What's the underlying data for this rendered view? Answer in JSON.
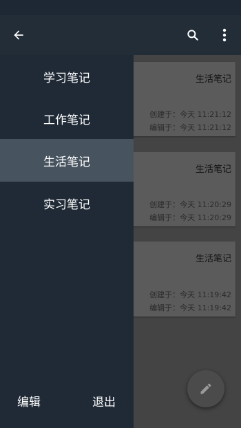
{
  "toolbar": {
    "back_icon": "arrow-left-icon",
    "search_icon": "search-icon",
    "more_icon": "more-vert-icon"
  },
  "drawer": {
    "categories": [
      {
        "label": "学习笔记"
      },
      {
        "label": "工作笔记"
      },
      {
        "label": "生活笔记",
        "selected": true
      },
      {
        "label": "实习笔记"
      }
    ],
    "edit_label": "编辑",
    "exit_label": "退出"
  },
  "notes": [
    {
      "category": "生活笔记",
      "created": "创建于：今天  11:21:12",
      "edited": "编辑于：今天  11:21:12"
    },
    {
      "category": "生活笔记",
      "created": "创建于：今天  11:20:29",
      "edited": "编辑于：今天  11:20:29"
    },
    {
      "category": "生活笔记",
      "created": "创建于：今天  11:19:42",
      "edited": "编辑于：今天  11:19:42"
    }
  ],
  "fab": {
    "icon": "pencil-icon"
  },
  "colors": {
    "toolbar": "#222d38",
    "drawer": "#1f2a36",
    "drawer_selected": "#47535f",
    "scrim": "#444444"
  }
}
